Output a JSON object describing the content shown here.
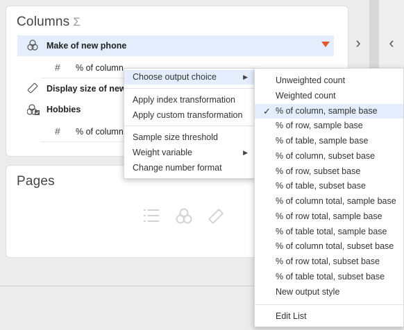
{
  "columns_panel": {
    "title": "Columns",
    "sigma": "Σ",
    "rows": [
      {
        "label": "Make of new phone",
        "icon": "venn-icon"
      },
      {
        "label": "% of column, sample b",
        "icon": "hash-icon"
      },
      {
        "label": "Display size of new p",
        "icon": "ruler-icon"
      },
      {
        "label": "Hobbies",
        "icon": "venn-check-icon"
      },
      {
        "label": "% of column",
        "icon": "hash-icon"
      }
    ]
  },
  "pages_panel": {
    "title": "Pages"
  },
  "context_menu": {
    "items": [
      {
        "label": "Choose output choice",
        "has_submenu": true
      },
      {
        "label": "Apply index transformation"
      },
      {
        "label": "Apply custom transformation"
      },
      {
        "label": "Sample size threshold"
      },
      {
        "label": "Weight variable",
        "has_submenu": true
      },
      {
        "label": "Change number format"
      }
    ]
  },
  "output_submenu": {
    "items": [
      "Unweighted count",
      "Weighted count",
      "% of column, sample base",
      "% of row, sample base",
      "% of table, sample base",
      "% of column, subset base",
      "% of row, subset base",
      "% of table, subset base",
      "% of column total, sample base",
      "% of row total, sample base",
      "% of table total, sample base",
      "% of column total, subset base",
      "% of row total, subset base",
      "% of table total, subset base",
      "New output style"
    ],
    "checked": "% of column, sample base",
    "footer_item": "Edit List"
  },
  "colors": {
    "accent": "#e0572c",
    "selection": "#e3edfb"
  }
}
